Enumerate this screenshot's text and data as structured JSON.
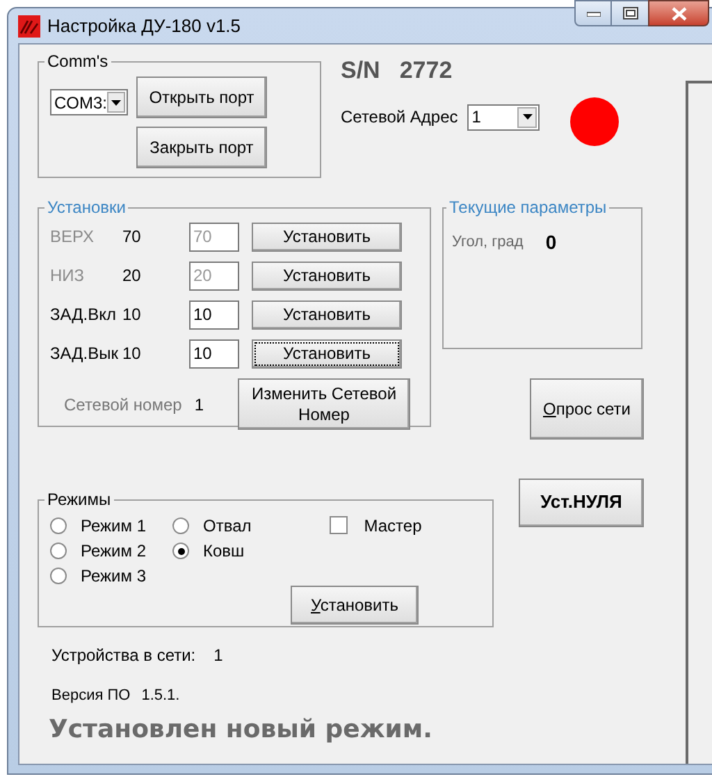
{
  "window": {
    "title": "Настройка ДУ-180 v1.5"
  },
  "comms": {
    "label": "Comm's",
    "port": "COM3:",
    "buttons": [
      "Открыть порт",
      "Закрыть порт"
    ]
  },
  "serial": {
    "label": "S/N",
    "value": "2772"
  },
  "network_address": {
    "label": "Сетевой Адрес",
    "value": "1"
  },
  "link": {
    "connected": false
  },
  "settings": {
    "label": "Установки",
    "rows": [
      {
        "name": "ВЕРХ",
        "value": "70",
        "input": "70",
        "disabled": true,
        "focused": false,
        "button": "Установить"
      },
      {
        "name": "НИЗ",
        "value": "20",
        "input": "20",
        "disabled": true,
        "focused": false,
        "button": "Установить"
      },
      {
        "name": "ЗАД.Вкл",
        "value": "10",
        "input": "10",
        "disabled": false,
        "focused": false,
        "button": "Установить"
      },
      {
        "name": "ЗАД.Вык",
        "value": "10",
        "input": "10",
        "disabled": false,
        "focused": true,
        "button": "Установить"
      }
    ],
    "network_number": {
      "label": "Сетевой номер",
      "value": "1"
    },
    "change_button": "Изменить Сетевой Номер"
  },
  "current": {
    "label": "Текущие параметры",
    "rows": [
      {
        "name": "Угол, град",
        "value": "0"
      }
    ]
  },
  "poll_button": {
    "label": "Опрос сети",
    "mnemonic": true
  },
  "zero_button": {
    "label": "Уст.НУЛЯ"
  },
  "modes": {
    "label": "Режимы",
    "options": [
      {
        "label": "Режим 1",
        "selected": false
      },
      {
        "label": "Режим 2",
        "selected": false
      },
      {
        "label": "Режим 3",
        "selected": false
      }
    ],
    "tools": [
      {
        "label": "Отвал",
        "selected": false
      },
      {
        "label": "Ковш",
        "selected": true
      }
    ],
    "master": {
      "label": "Мастер",
      "checked": false
    },
    "button": {
      "label": "Установить",
      "mnemonic": true
    }
  },
  "devices": {
    "label": "Устройства в сети:",
    "value": "1"
  },
  "version": {
    "label": "Версия ПО",
    "value": "1.5.1."
  },
  "status_message": "Установлен новый режим."
}
